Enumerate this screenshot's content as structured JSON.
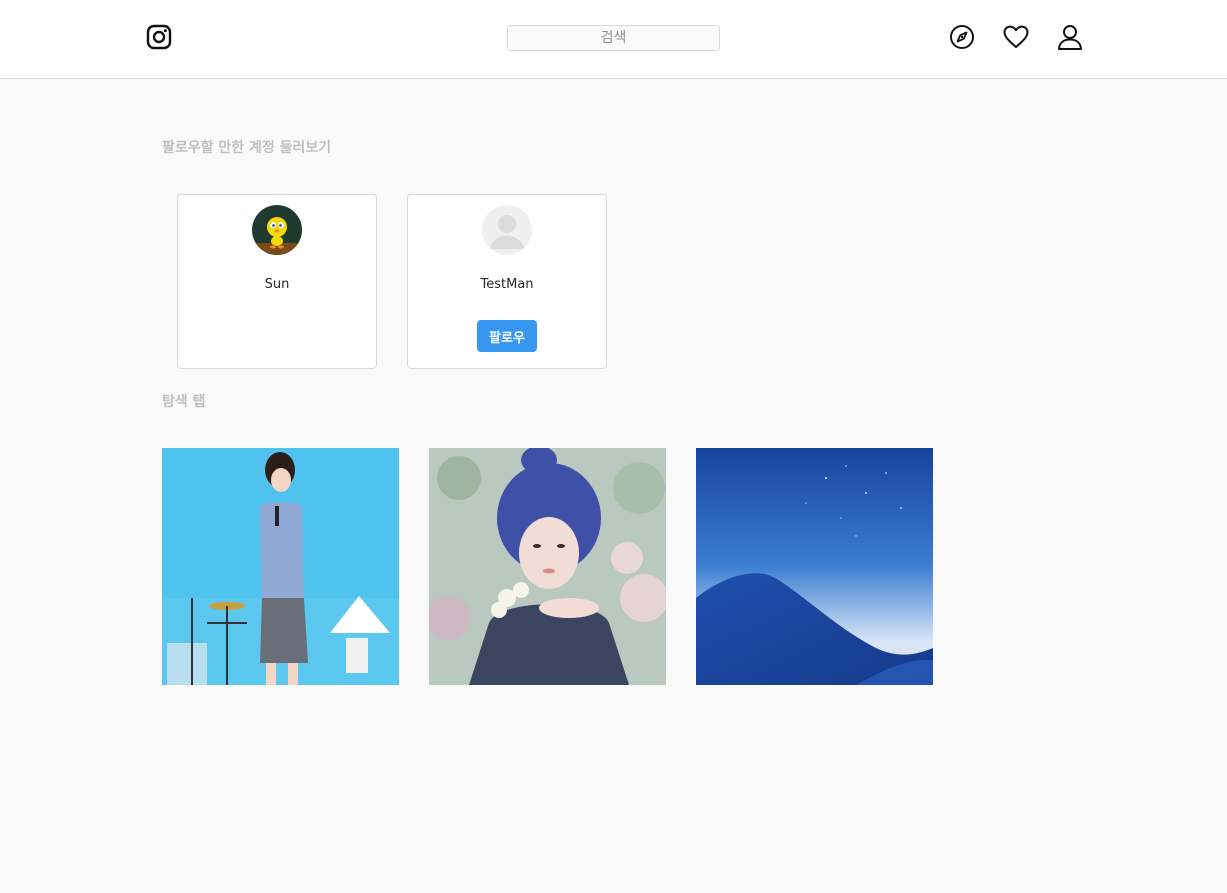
{
  "header": {
    "search_placeholder": "검색",
    "icons": [
      "instagram-logo-icon",
      "compass-icon",
      "heart-icon",
      "user-icon"
    ]
  },
  "suggestions": {
    "title": "팔로우할 만한 계정 둘러보기",
    "cards": [
      {
        "name": "Sun",
        "avatar": "cartoon-bird-avatar",
        "button": ""
      },
      {
        "name": "TestMan",
        "avatar": "default-avatar",
        "button": "팔로우"
      }
    ]
  },
  "explore": {
    "title": "탐색 탭",
    "tiles": [
      "singer-performing-photo",
      "blue-hair-portrait-photo",
      "blue-mountain-sky-photo"
    ]
  },
  "colors": {
    "accent": "#3897f0",
    "background": "#fafafa",
    "border": "#dbdbdb"
  }
}
